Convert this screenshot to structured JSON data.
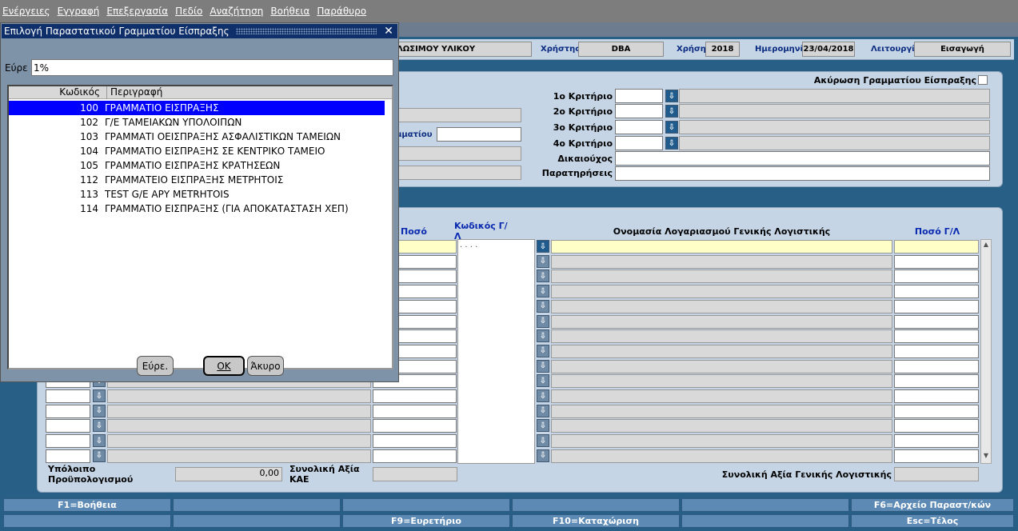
{
  "menu": [
    "Ενέργειες",
    "Εγγραφή",
    "Επεξεργασία",
    "Πεδίο",
    "Αναζήτηση",
    "Βοήθεια",
    "Παράθυρο"
  ],
  "header": {
    "form_title_fragment": "ΛΩΣΙΜΟΥ ΥΛΙΚΟΥ",
    "user_label": "Χρήστης",
    "user_value": "DBA",
    "year_label": "Χρήση",
    "year_value": "2018",
    "date_label": "Ημερομηνία",
    "date_value": "23/04/2018",
    "mode_label": "Λειτουργία",
    "mode_value": "Εισαγωγή"
  },
  "criteria": {
    "cancel_label": "Ακύρωση Γραμματίου Είσπραξης",
    "c1": "1ο Κριτήριο",
    "c2": "2ο Κριτήριο",
    "c3": "3ο Κριτήριο",
    "c4": "4ο Κριτήριο",
    "beneficiary": "Δικαιούχος",
    "remarks": "Παρατηρήσεις",
    "partial_label": "μματίου"
  },
  "grid": {
    "col_amount": "Ποσό",
    "col_gl_code": "Κωδικός Γ/Λ",
    "col_gl_name": "Ονομασία Λογαριασμού Γενικής Λογιστικής",
    "col_gl_amount": "Ποσό Γ/Λ",
    "first_gl_code_mask": ".   .   .   ."
  },
  "footer": {
    "budget_label": "Υπόλοιπο Προϋπολογισμού",
    "budget_value": "0,00",
    "kae_total_label": "Συνολική Αξία ΚΑΕ",
    "gl_total_label": "Συνολική Αξία Γενικής Λογιστικής"
  },
  "fkeys": {
    "f1": "F1=Βοήθεια",
    "f6": "F6=Αρχείο Παραστ/κών",
    "f9": "F9=Ευρετήριο",
    "f10": "F10=Καταχώριση",
    "esc": "Esc=Τέλος"
  },
  "dialog": {
    "title": "Επιλογή Παραστατικού Γραμματίου Είσπραξης",
    "find_label": "Εύρε",
    "find_value": "1%",
    "col_code": "Κωδικός",
    "col_desc": "Περιγραφή",
    "rows": [
      {
        "code": "100",
        "desc": "ΓΡΑΜΜΑΤΙΟ ΕΙΣΠΡΑΞΗΣ"
      },
      {
        "code": "102",
        "desc": "Γ/Ε ΤΑΜΕΙΑΚΩΝ ΥΠΟΛΟΙΠΩΝ"
      },
      {
        "code": "103",
        "desc": "ΓΡΑΜΜΑΤΙ ΟΕΙΣΠΡΑΞΗΣ ΑΣΦΑΛΙΣΤΙΚΩΝ ΤΑΜΕΙΩΝ"
      },
      {
        "code": "104",
        "desc": "ΓΡΑΜΜΑΤΙΟ ΕΙΣΠΡΑΞΗΣ ΣΕ ΚΕΝΤΡΙΚΟ ΤΑΜΕΙΟ"
      },
      {
        "code": "105",
        "desc": "ΓΡΑΜΜΑΤΙΟ ΕΙΣΠΡΑΞΗΣ ΚΡΑΤΗΣΕΩΝ"
      },
      {
        "code": "112",
        "desc": "ΓΡΑΜΜΑΤΕΙΟ ΕΙΣΠΡΑΞΗΣ ΜΕΤΡΗΤΟΙΣ"
      },
      {
        "code": "113",
        "desc": "TEST G/E ΑΡΥ METRHTOIS"
      },
      {
        "code": "114",
        "desc": "ΓΡΑΜΜΑΤΙΟ ΕΙΣΠΡΑΞΗΣ (ΓΙΑ ΑΠΟΚΑΤΑΣΤΑΣΗ ΧΕΠ)"
      }
    ],
    "btn_find": "Εύρε.",
    "btn_ok": "OK",
    "btn_cancel": "Άκυρο"
  }
}
